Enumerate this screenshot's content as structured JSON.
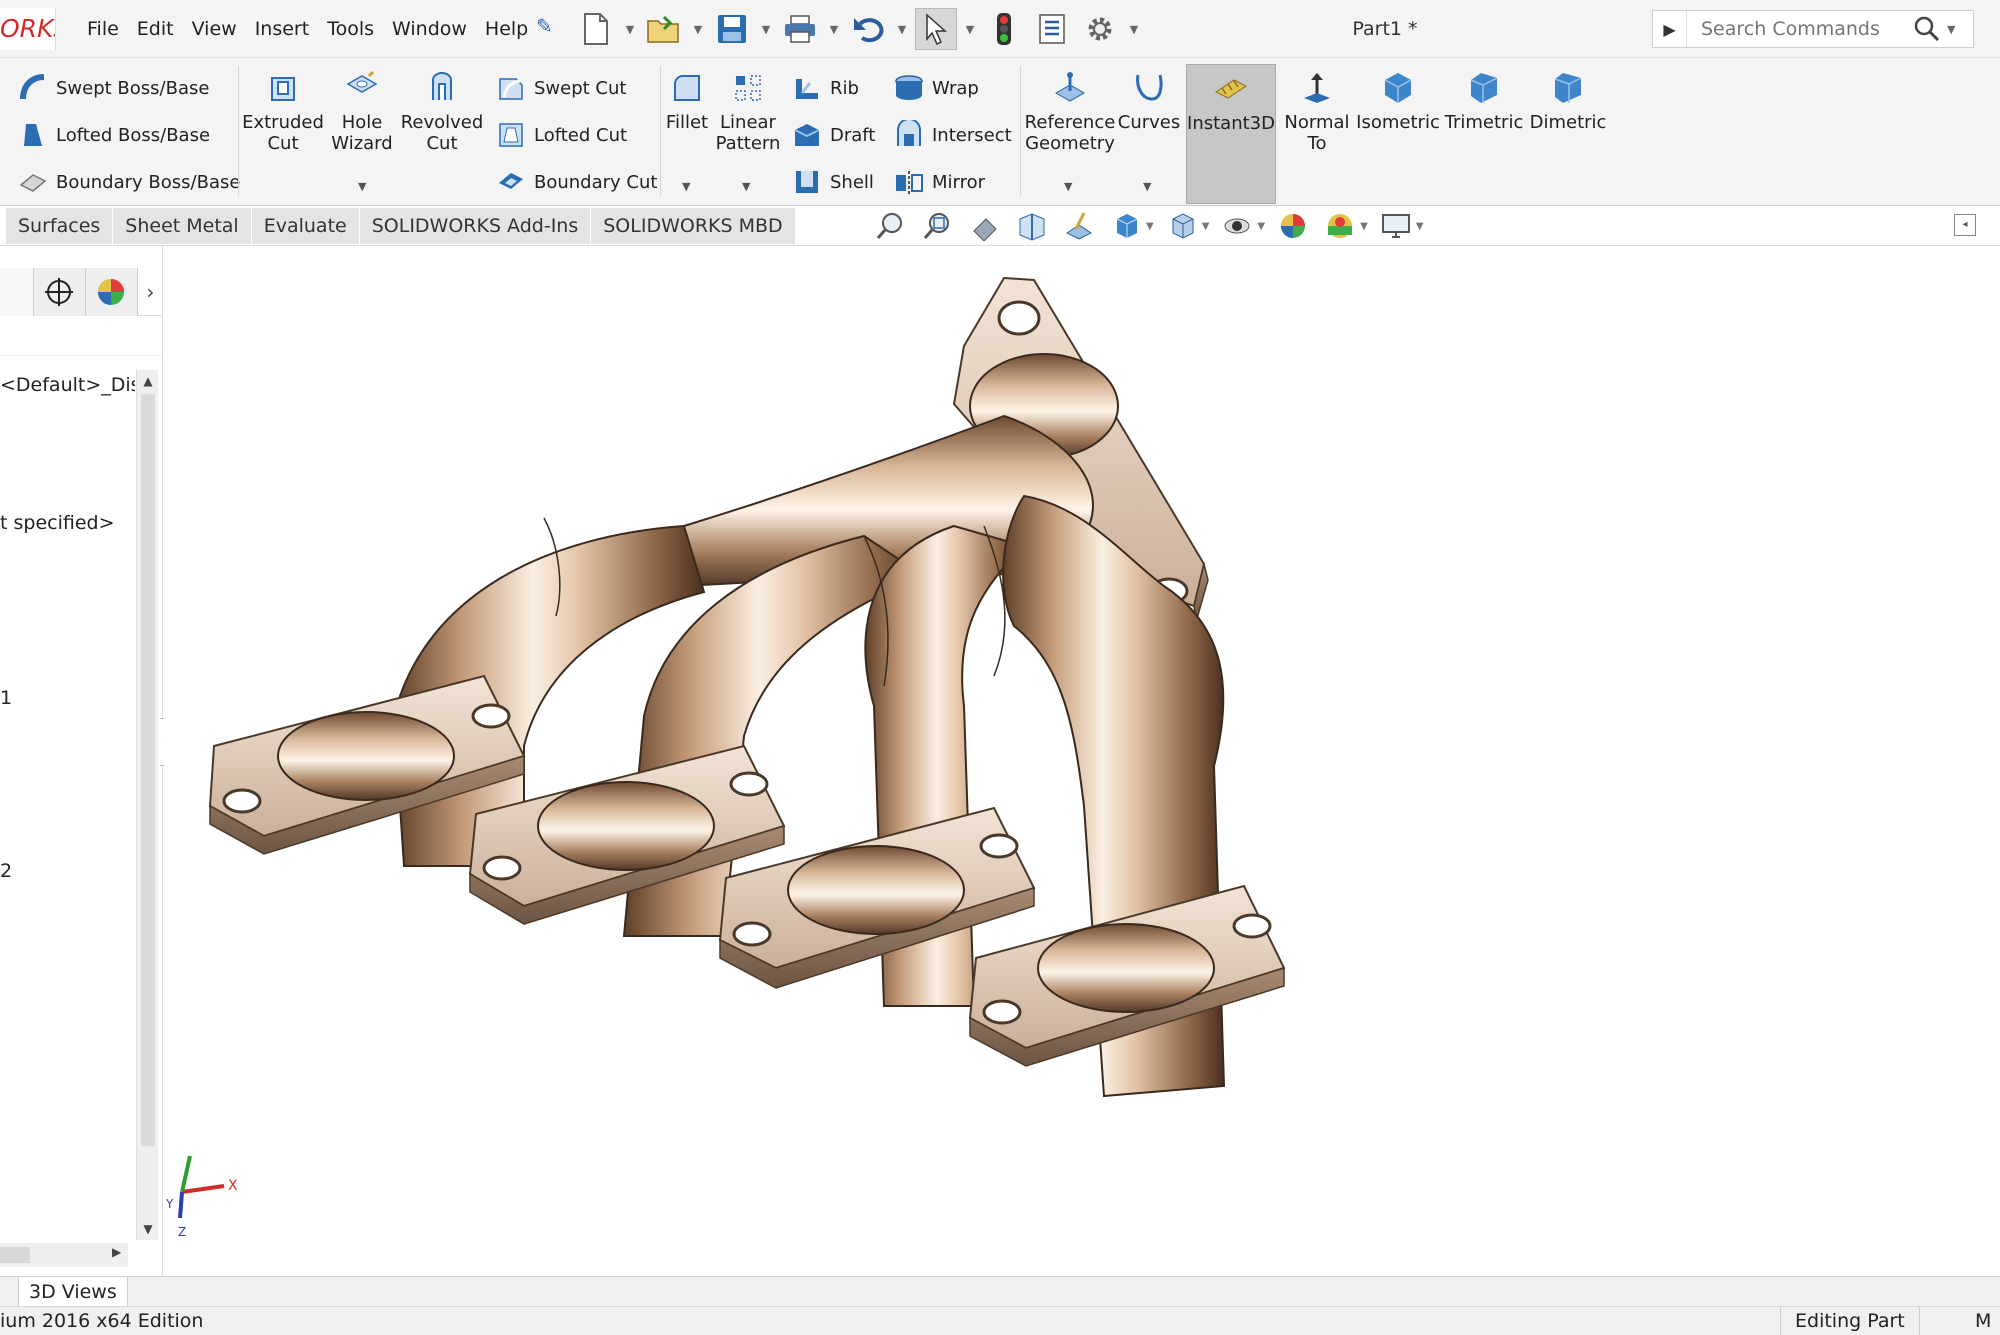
{
  "app": {
    "logo_text": "ORKS",
    "document_title": "Part1 *"
  },
  "menu": [
    "File",
    "Edit",
    "View",
    "Insert",
    "Tools",
    "Window",
    "Help"
  ],
  "search": {
    "placeholder": "Search Commands"
  },
  "ribbon": {
    "boss_base": [
      "Swept Boss/Base",
      "Lofted Boss/Base",
      "Boundary Boss/Base"
    ],
    "extruded_cut": "Extruded Cut",
    "hole_wizard": "Hole Wizard",
    "revolved_cut": "Revolved Cut",
    "cuts": [
      "Swept Cut",
      "Lofted Cut",
      "Boundary Cut"
    ],
    "fillet": "Fillet",
    "linear_pattern": "Linear Pattern",
    "features_a": [
      "Rib",
      "Draft",
      "Shell"
    ],
    "features_b": [
      "Wrap",
      "Intersect",
      "Mirror"
    ],
    "reference_geometry": "Reference Geometry",
    "curves": "Curves",
    "instant3d": "Instant3D",
    "normal_to": "Normal To",
    "isometric": "Isometric",
    "trimetric": "Trimetric",
    "dimetric": "Dimetric"
  },
  "tabs": [
    "Surfaces",
    "Sheet Metal",
    "Evaluate",
    "SOLIDWORKS Add-Ins",
    "SOLIDWORKS MBD"
  ],
  "tree": {
    "display_state": "<Default>_Disp",
    "material": "t specified>",
    "row_a": "1",
    "row_b": "2"
  },
  "bottom_tab": "3D Views",
  "status": {
    "edition": "ium 2016 x64 Edition",
    "mode": "Editing Part",
    "unit": "M"
  },
  "triad": {
    "x": "X",
    "y": "Y",
    "z": "Z"
  },
  "colors": {
    "accent": "#2c5d9a",
    "logo": "#d12b2b",
    "metal_light": "#f6e6d4",
    "metal_dark": "#6e4a30"
  }
}
